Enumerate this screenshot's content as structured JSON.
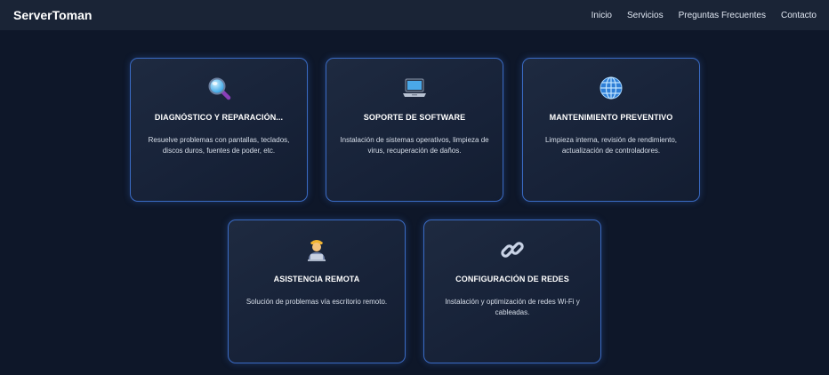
{
  "brand": "ServerToman",
  "nav": [
    "Inicio",
    "Servicios",
    "Preguntas Frecuentes",
    "Contacto"
  ],
  "services": [
    {
      "icon": "magnifier-icon",
      "title": "DIAGNÓSTICO Y REPARACIÓN...",
      "description": "Resuelve problemas con pantallas, teclados, discos duros, fuentes de poder, etc."
    },
    {
      "icon": "laptop-icon",
      "title": "SOPORTE DE SOFTWARE",
      "description": "Instalación de sistemas operativos, limpieza de virus, recuperación de daños."
    },
    {
      "icon": "globe-icon",
      "title": "MANTENIMIENTO PREVENTIVO",
      "description": "Limpieza interna, revisión de rendimiento, actualización de controladores."
    },
    {
      "icon": "technician-icon",
      "title": "ASISTENCIA REMOTA",
      "description": "Solución de problemas vía escritorio remoto."
    },
    {
      "icon": "link-icon",
      "title": "CONFIGURACIÓN DE REDES",
      "description": "Instalación y optimización de redes Wi-Fi y cableadas."
    }
  ],
  "colors": {
    "background": "#0e1729",
    "navbar": "#1a2436",
    "card_border": "#3a6bc4"
  }
}
